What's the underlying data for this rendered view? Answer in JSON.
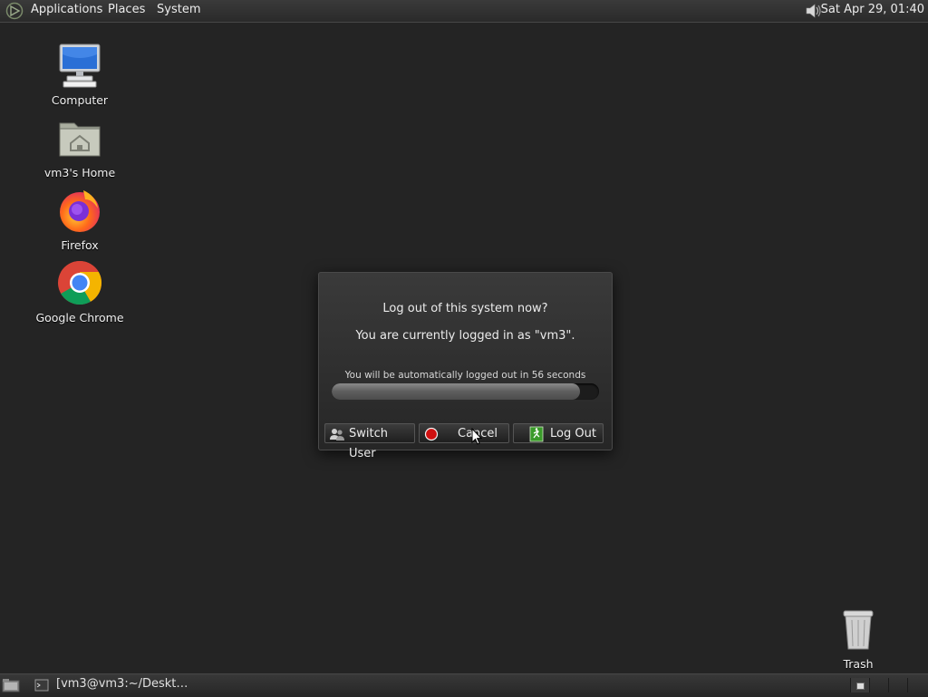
{
  "top_panel": {
    "menus": [
      "Applications",
      "Places",
      "System"
    ],
    "clock": "Sat Apr 29, 01:40",
    "volume_icon": "speaker-icon"
  },
  "desktop": {
    "icons": [
      {
        "label": "Computer",
        "icon": "computer-icon"
      },
      {
        "label": "vm3's Home",
        "icon": "home-folder-icon"
      },
      {
        "label": "Firefox",
        "icon": "firefox-icon"
      },
      {
        "label": "Google Chrome",
        "icon": "chrome-icon"
      },
      {
        "label": "Trash",
        "icon": "trash-icon"
      }
    ]
  },
  "logout_dialog": {
    "title": "Log out of this system now?",
    "subtitle": "You are currently logged in as \"vm3\".",
    "countdown": "You will be automatically logged out in 56 seconds",
    "progress_fraction": 0.93,
    "buttons": {
      "switch_user": "Switch User",
      "cancel": "Cancel",
      "log_out": "Log Out"
    }
  },
  "bottom_panel": {
    "task_title": "[vm3@vm3:~/Deskt…",
    "workspaces": 4
  },
  "colors": {
    "desktop_bg": "#242424",
    "cancel_icon": "#d01010",
    "logout_icon": "#3a9a2a"
  }
}
